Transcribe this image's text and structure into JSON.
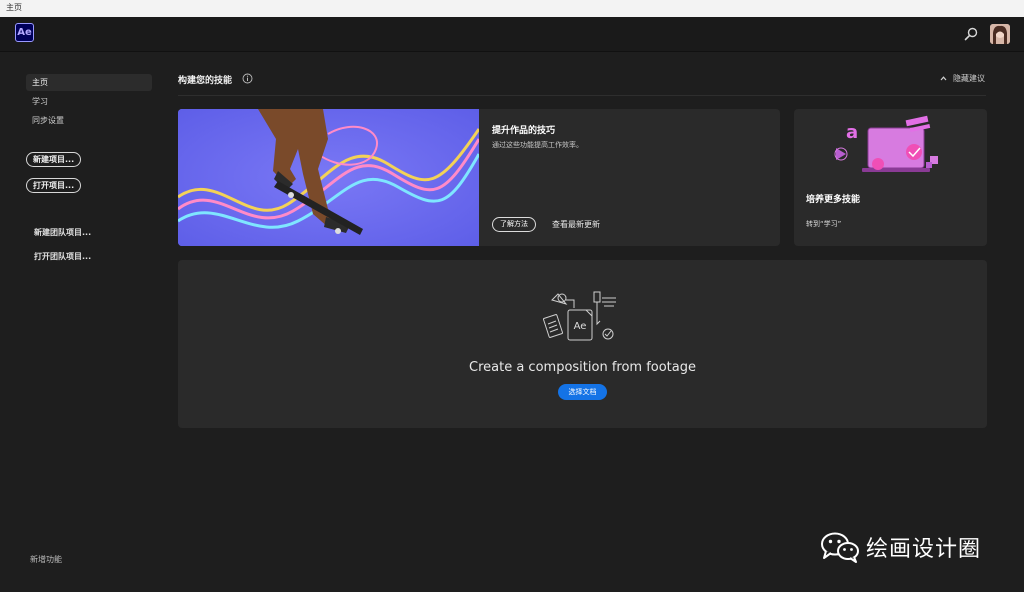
{
  "window": {
    "title": "主页"
  },
  "appbar": {
    "logo_text": "Ae",
    "search_icon": "search-icon",
    "avatar": "avatar"
  },
  "sidebar": {
    "nav": [
      {
        "label": "主页",
        "active": true
      },
      {
        "label": "学习",
        "active": false
      },
      {
        "label": "同步设置",
        "active": false
      }
    ],
    "new_project": "新建项目...",
    "open_project": "打开项目...",
    "new_team_project": "新建团队项目...",
    "open_team_project": "打开团队项目...",
    "whats_new": "新增功能"
  },
  "main": {
    "section_title": "构建您的技能",
    "hide_suggestions": "隐藏建议",
    "hero_card": {
      "title": "提升作品的技巧",
      "desc": "通过这些功能提高工作效率。",
      "learn_button": "了解方法",
      "latest_link": "查看最新更新"
    },
    "skills_card": {
      "title": "培养更多技能",
      "link": "转到“学习”"
    },
    "composition_card": {
      "title": "Create a composition from footage",
      "select_button": "选择文档"
    }
  },
  "watermark": {
    "text": "绘画设计圈"
  },
  "colors": {
    "accent_blue": "#1473e6",
    "ae_purple": "#9999ff",
    "ae_bg": "#00005b",
    "hero_bg": "#6a6af0"
  }
}
